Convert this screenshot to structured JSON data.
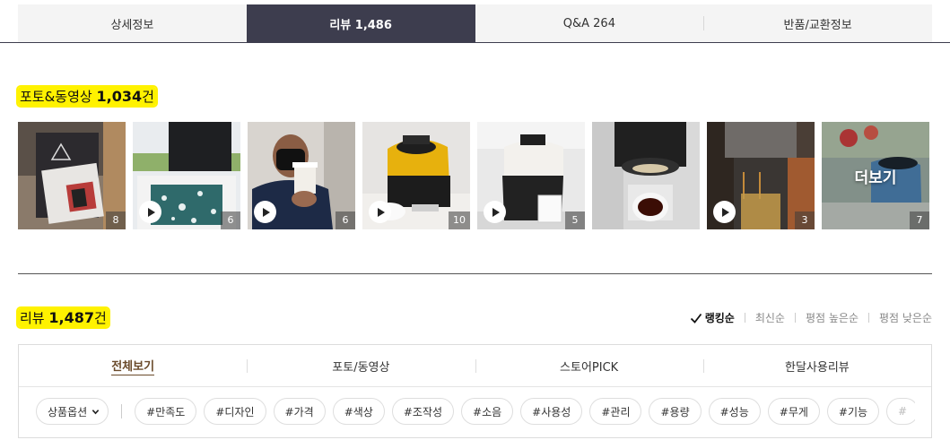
{
  "tabs": [
    {
      "label": "상세정보",
      "active": false
    },
    {
      "label": "리뷰 1,486",
      "active": true
    },
    {
      "label": "Q&A 264",
      "active": false
    },
    {
      "label": "반품/교환정보",
      "active": false
    }
  ],
  "photo_section": {
    "title_prefix": "포토&동영상",
    "title_count": "1,034",
    "title_suffix": "건",
    "thumbnails": [
      {
        "count": "8",
        "video": false
      },
      {
        "count": "6",
        "video": true
      },
      {
        "count": "6",
        "video": true
      },
      {
        "count": "10",
        "video": true
      },
      {
        "count": "5",
        "video": true
      },
      {
        "count": "",
        "video": false
      },
      {
        "count": "3",
        "video": true
      },
      {
        "count": "7",
        "video": false,
        "more_label": "더보기"
      }
    ]
  },
  "review_section": {
    "title_prefix": "리뷰",
    "title_count": "1,487",
    "title_suffix": "건",
    "sort_options": [
      {
        "label": "랭킹순",
        "active": true
      },
      {
        "label": "최신순",
        "active": false
      },
      {
        "label": "평점 높은순",
        "active": false
      },
      {
        "label": "평점 낮은순",
        "active": false
      }
    ],
    "filter_tabs": [
      {
        "label": "전체보기",
        "active": true
      },
      {
        "label": "포토/동영상",
        "active": false
      },
      {
        "label": "스토어PICK",
        "active": false
      },
      {
        "label": "한달사용리뷰",
        "active": false
      }
    ],
    "option_dropdown": "상품옵션",
    "tags": [
      "#만족도",
      "#디자인",
      "#가격",
      "#색상",
      "#조작성",
      "#소음",
      "#사용성",
      "#관리",
      "#용량",
      "#성능",
      "#무게",
      "#기능",
      "#"
    ]
  },
  "colors": {
    "active_tab_bg": "#3d3d4e",
    "highlight": "#fff200",
    "active_filter_text": "#6a4a2a"
  }
}
